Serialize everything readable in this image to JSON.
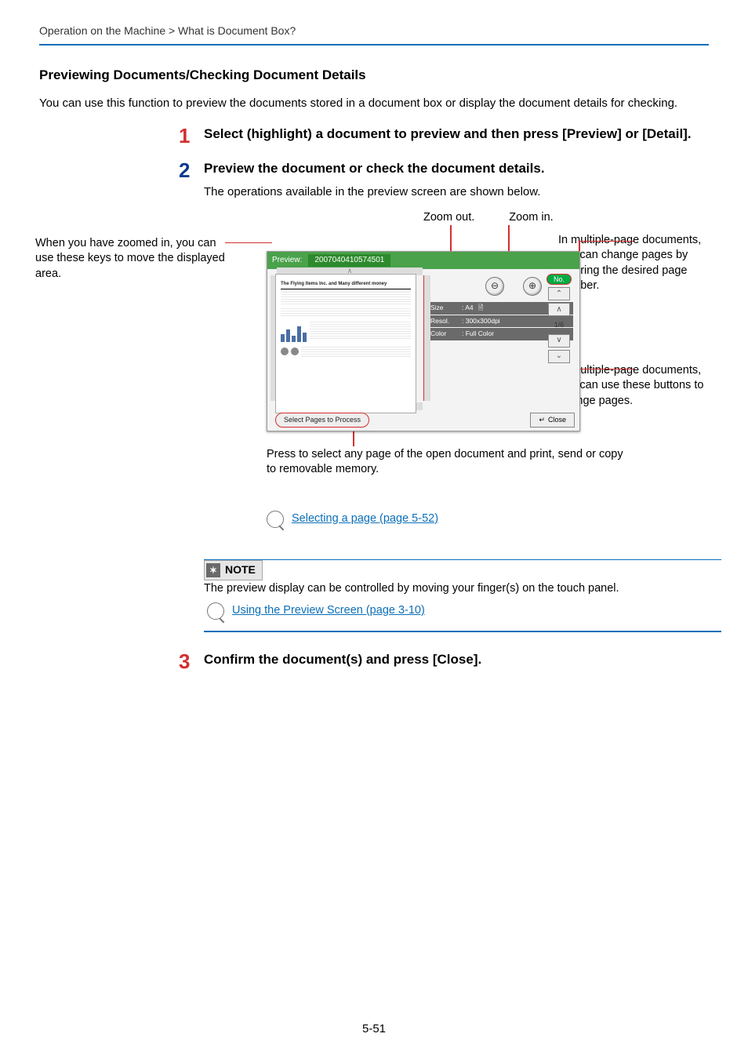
{
  "breadcrumb": "Operation on the Machine > What is Document Box?",
  "heading": "Previewing Documents/Checking Document Details",
  "intro": "You can use this function to preview the documents stored in a document box or display the document details for checking.",
  "steps": {
    "s1": {
      "num": "1",
      "title": "Select (highlight) a document to preview and then press [Preview] or [Detail]."
    },
    "s2": {
      "num": "2",
      "title": "Preview the document or check the document details.",
      "sub": "The operations available in the preview screen are shown below."
    },
    "s3": {
      "num": "3",
      "title": "Confirm the document(s) and press [Close]."
    }
  },
  "callouts": {
    "left": "When you have zoomed in, you can use these keys to move the displayed area.",
    "zoom_out": "Zoom out.",
    "zoom_in": "Zoom in.",
    "right1": "In multiple-page documents, you can change pages by entering the desired page number.",
    "right2": "In multiple-page documents, you can use these buttons to change pages.",
    "below": "Press to select any page of the open document and print, send or copy to removable memory."
  },
  "screen": {
    "title_label": "Preview:",
    "filename": "2007040410574501",
    "no_label": "No.",
    "meta": {
      "size_label": "Size",
      "size_value": ":  A4",
      "resol_label": "Resol.",
      "resol_value": ":  300x300dpi",
      "color_label": "Color",
      "color_value": ":  Full Color"
    },
    "page_count": "1/6",
    "select_btn": "Select Pages to Process",
    "close_btn": "Close",
    "doc_hdr": "The Flying Items Inc. and Many different money"
  },
  "links": {
    "select_page": "Selecting a page (page 5-52)",
    "preview_screen": "Using the Preview Screen (page 3-10)"
  },
  "note": {
    "label": "NOTE",
    "body": "The preview display can be controlled by moving your finger(s) on the touch panel."
  },
  "pagenum": "5-51",
  "icons": {
    "zoom_out": "⊖",
    "zoom_in": "⊕",
    "enter": "↵",
    "gear": "✶",
    "caret_up": "∧",
    "caret_down": "∨",
    "go_top": "⌃",
    "go_bottom": "⌄",
    "page_icon": "🗎"
  }
}
